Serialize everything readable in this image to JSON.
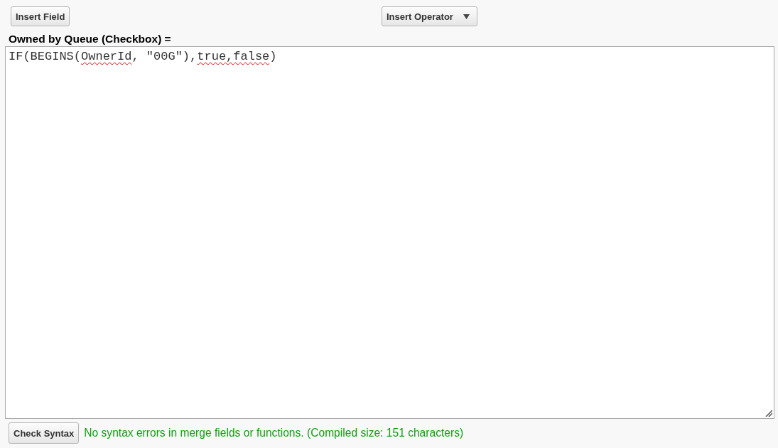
{
  "toolbar": {
    "buttons": [
      {
        "label": "Insert Field",
        "kind": "button"
      },
      {
        "label": "Insert Operator",
        "kind": "dropdown"
      }
    ]
  },
  "formula": {
    "label": "Owned by Queue (Checkbox) =",
    "segments": [
      {
        "text": "IF(BEGINS(",
        "misspelled": false
      },
      {
        "text": "OwnerId",
        "misspelled": true
      },
      {
        "text": ", \"00G\"),",
        "misspelled": false
      },
      {
        "text": "true,false",
        "misspelled": true
      },
      {
        "text": ")",
        "misspelled": false
      }
    ]
  },
  "footer": {
    "button": "Check Syntax",
    "message": "No syntax errors in merge fields or functions. (Compiled size: 151 characters)"
  }
}
